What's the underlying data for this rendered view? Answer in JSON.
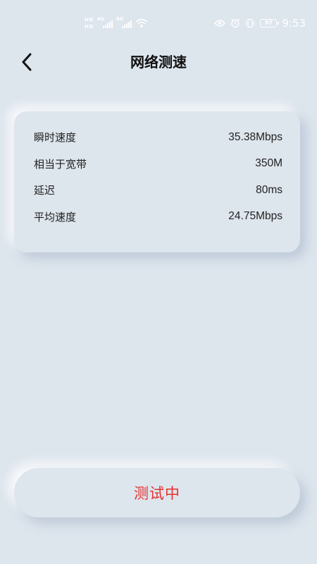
{
  "status_bar": {
    "hd_labels": [
      "HD",
      "HD"
    ],
    "network_gen": [
      "4G",
      "4G"
    ],
    "time": "9:53",
    "battery": "97",
    "icons": [
      "eye-icon",
      "alarm-icon",
      "vibrate-icon",
      "wifi-icon",
      "signal-icon"
    ]
  },
  "header": {
    "title": "网络测速",
    "back_icon": "chevron-left-icon"
  },
  "stats": [
    {
      "label": "瞬时速度",
      "value": "35.38Mbps"
    },
    {
      "label": "相当于宽带",
      "value": "350M"
    },
    {
      "label": "延迟",
      "value": "80ms"
    },
    {
      "label": "平均速度",
      "value": "24.75Mbps"
    }
  ],
  "action": {
    "label": "测试中",
    "color": "#e8302c"
  },
  "colors": {
    "background": "#dde5ed",
    "accent": "#e8302c"
  }
}
